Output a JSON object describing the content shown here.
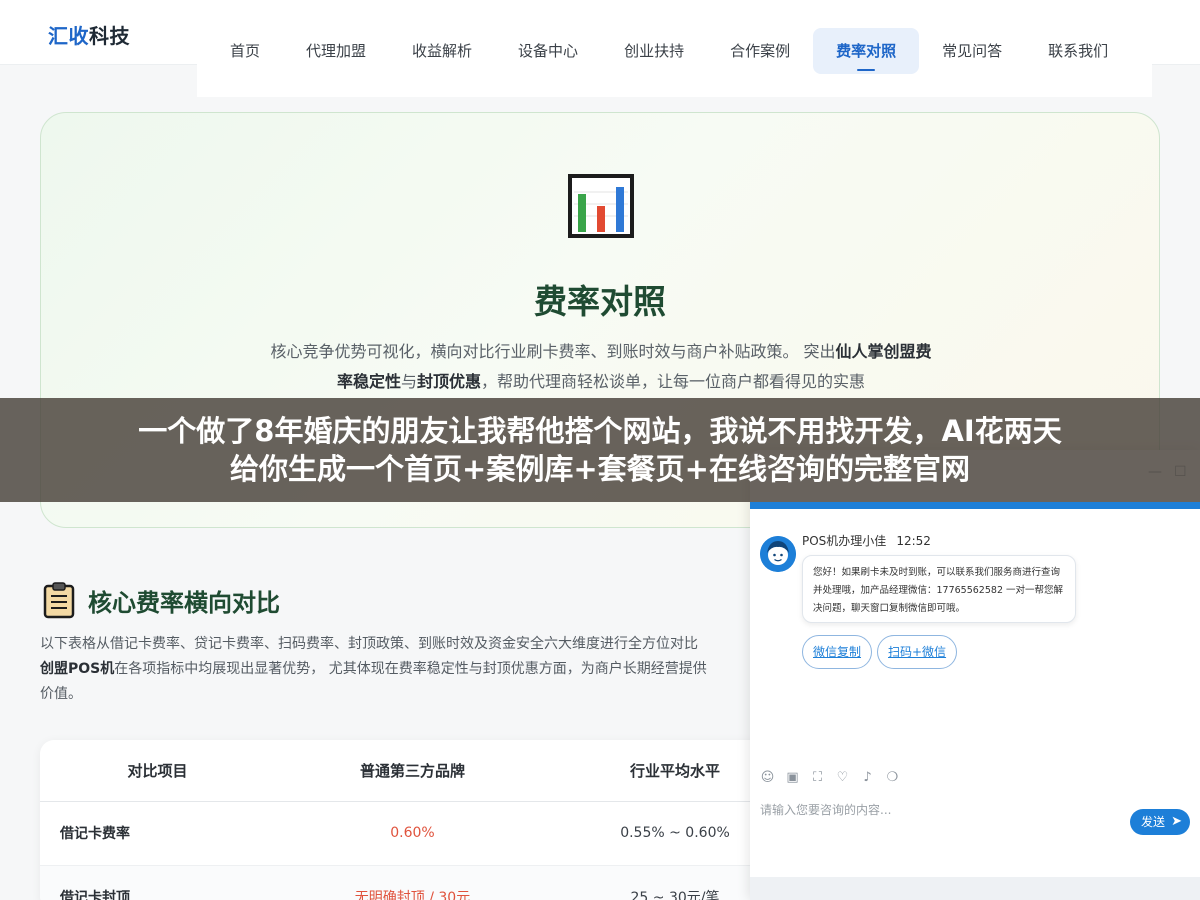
{
  "header": {
    "logo_accent": "汇收",
    "logo_rest": "科技",
    "nav": [
      {
        "label": "首页"
      },
      {
        "label": "代理加盟"
      },
      {
        "label": "收益解析"
      },
      {
        "label": "设备中心"
      },
      {
        "label": "创业扶持"
      },
      {
        "label": "合作案例"
      },
      {
        "label": "费率对照",
        "active": true
      },
      {
        "label": "常见问答"
      },
      {
        "label": "联系我们"
      }
    ]
  },
  "hero": {
    "icon": "bar-chart-icon",
    "title": "费率对照",
    "desc_1": "核心竞争优势可视化，横向对比行业刷卡费率、到账时效与商户补贴政策。 突出",
    "desc_b1": "仙人掌创盟费率稳定性",
    "desc_2": "与",
    "desc_b2": "封顶优惠",
    "desc_3": "，帮助代理商轻松谈单，让每一位商户都看得见的实惠"
  },
  "section": {
    "icon": "clipboard-icon",
    "title": "核心费率横向对比",
    "desc_1": "以下表格从借记卡费率、贷记卡费率、扫码费率、封顶政策、到账时效及资金安全六大维度进行全方位对比",
    "desc_b": "创盟POS机",
    "desc_2": "在各项指标中均展现出显著优势， 尤其体现在费率稳定性与封顶优惠方面，为商户长期经营提供",
    "desc_3": "价值。"
  },
  "table": {
    "headers": [
      "对比项目",
      "普通第三方品牌",
      "行业平均水平"
    ],
    "rows": [
      [
        "借记卡费率",
        "0.60%",
        "0.55% ~ 0.60%"
      ],
      [
        "借记卡封顶",
        "无明确封顶 / 30元",
        "25 ~ 30元/笔"
      ]
    ]
  },
  "banner": {
    "line1": "一个做了8年婚庆的朋友让我帮他搭个网站，我说不用找开发，AI花两天",
    "line2": "给你生成一个首页+案例库+套餐页+在线咨询的完整官网"
  },
  "chat": {
    "minimize_icon": "minimize-icon",
    "maximize_icon": "maximize-icon",
    "sender": "POS机办理小佳",
    "time": "12:52",
    "message": "您好！如果刷卡未及时到账，可以联系我们服务商进行查询并处理哦，加产品经理微信：17765562582 一对一帮您解决问题，聊天窗口复制微信即可哦。",
    "quick_replies": [
      "微信复制",
      "扫码+微信"
    ],
    "toolbar_icons": [
      "emoji-icon",
      "image-icon",
      "screenshot-icon",
      "evaluate-icon",
      "voice-icon",
      "chat-record-icon"
    ],
    "input_placeholder": "请输入您要咨询的内容...",
    "send_label": "发送",
    "accent": "#1d7fd8"
  }
}
